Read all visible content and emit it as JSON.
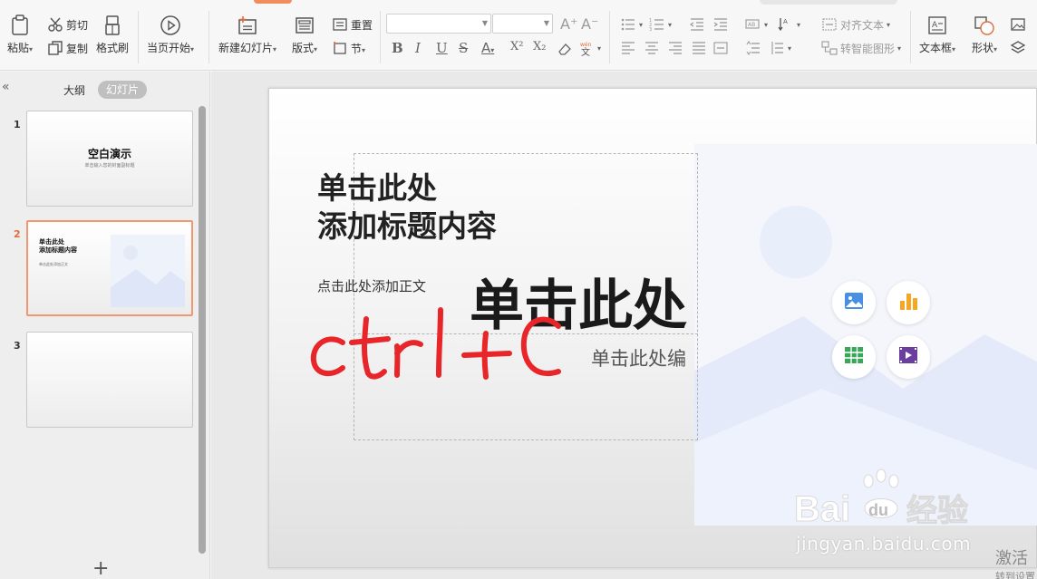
{
  "ribbon": {
    "paste_label": "粘贴",
    "cut_label": "剪切",
    "copy_label": "复制",
    "format_painter_label": "格式刷",
    "from_current_label": "当页开始",
    "new_slide_label": "新建幻灯片",
    "layout_label": "版式",
    "reset_label": "重置",
    "section_label": "节",
    "align_text_label": "对齐文本",
    "smartart_label": "转智能图形",
    "textbox_label": "文本框",
    "shape_label": "形状",
    "font_bold": "B",
    "font_italic": "I",
    "font_underline": "U",
    "font_strike": "S",
    "font_color": "A",
    "superscript": "X²",
    "subscript": "X₂",
    "grow_font": "A⁺",
    "shrink_font": "A⁻"
  },
  "sidebar": {
    "outline_tab": "大纲",
    "slides_tab": "幻灯片",
    "thumbnails": [
      {
        "number": "1",
        "title": "空白演示",
        "subtitle": "单击输入您的封面副标题"
      },
      {
        "number": "2",
        "title": "单击此处\n添加标题内容",
        "subtitle": "单击此处添加正文"
      },
      {
        "number": "3"
      }
    ],
    "add_slide": "+"
  },
  "slide": {
    "title_placeholder_line1": "单击此处",
    "title_placeholder_line2": "添加标题内容",
    "body_placeholder": "点击此处添加正文",
    "pasted_title": "单击此处",
    "pasted_subtitle": "单击此处编",
    "handwritten_annotation": "ctrl+C"
  },
  "watermark": {
    "brand": "Baidu经验",
    "url": "jingyan.baidu.com"
  },
  "activation": {
    "line1": "激活",
    "line2": "转到设置"
  },
  "colors": {
    "accent": "#e36b3b",
    "handwriting": "#e8262a"
  }
}
